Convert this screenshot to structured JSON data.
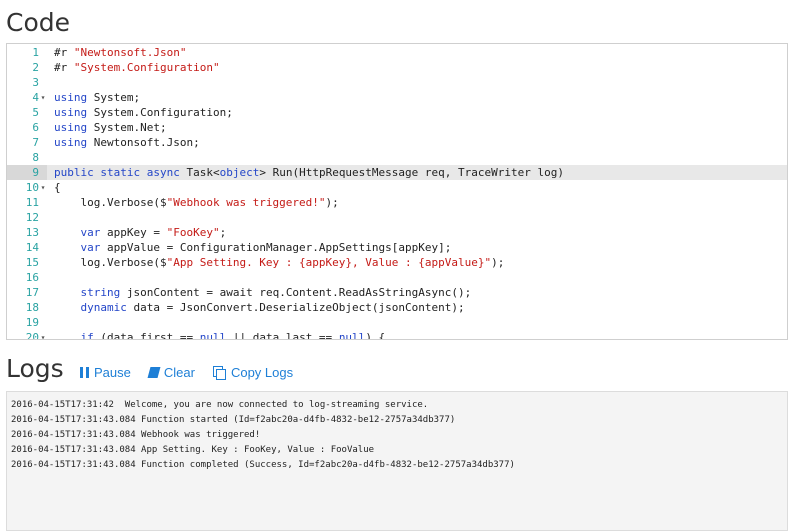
{
  "code_section": {
    "title": "Code",
    "lines": [
      {
        "num": "1",
        "fold": "",
        "tokens": [
          {
            "t": "#r "
          },
          {
            "t": "\"Newtonsoft.Json\"",
            "c": "str"
          }
        ]
      },
      {
        "num": "2",
        "fold": "",
        "tokens": [
          {
            "t": "#r "
          },
          {
            "t": "\"System.Configuration\"",
            "c": "str"
          }
        ]
      },
      {
        "num": "3",
        "fold": "",
        "tokens": []
      },
      {
        "num": "4",
        "fold": "▾",
        "tokens": [
          {
            "t": "using",
            "c": "kw"
          },
          {
            "t": " System;"
          }
        ]
      },
      {
        "num": "5",
        "fold": "",
        "tokens": [
          {
            "t": "using",
            "c": "kw"
          },
          {
            "t": " System.Configuration;"
          }
        ]
      },
      {
        "num": "6",
        "fold": "",
        "tokens": [
          {
            "t": "using",
            "c": "kw"
          },
          {
            "t": " System.Net;"
          }
        ]
      },
      {
        "num": "7",
        "fold": "",
        "tokens": [
          {
            "t": "using",
            "c": "kw"
          },
          {
            "t": " Newtonsoft.Json;"
          }
        ]
      },
      {
        "num": "8",
        "fold": "",
        "tokens": []
      },
      {
        "num": "9",
        "fold": "",
        "active": true,
        "tokens": [
          {
            "t": "public static async",
            "c": "kw"
          },
          {
            "t": " Task<"
          },
          {
            "t": "object",
            "c": "kw"
          },
          {
            "t": "> Run(HttpRequestMessage req, TraceWriter log)"
          }
        ]
      },
      {
        "num": "10",
        "fold": "▾",
        "tokens": [
          {
            "t": "{"
          }
        ]
      },
      {
        "num": "11",
        "fold": "",
        "tokens": [
          {
            "t": "    log.Verbose($"
          },
          {
            "t": "\"Webhook was triggered!\"",
            "c": "str"
          },
          {
            "t": ");"
          }
        ]
      },
      {
        "num": "12",
        "fold": "",
        "tokens": []
      },
      {
        "num": "13",
        "fold": "",
        "tokens": [
          {
            "t": "    "
          },
          {
            "t": "var",
            "c": "kw"
          },
          {
            "t": " appKey = "
          },
          {
            "t": "\"FooKey\"",
            "c": "str"
          },
          {
            "t": ";"
          }
        ]
      },
      {
        "num": "14",
        "fold": "",
        "tokens": [
          {
            "t": "    "
          },
          {
            "t": "var",
            "c": "kw"
          },
          {
            "t": " appValue = ConfigurationManager.AppSettings[appKey];"
          }
        ]
      },
      {
        "num": "15",
        "fold": "",
        "tokens": [
          {
            "t": "    log.Verbose($"
          },
          {
            "t": "\"App Setting. Key : {appKey}, Value : {appValue}\"",
            "c": "str"
          },
          {
            "t": ");"
          }
        ]
      },
      {
        "num": "16",
        "fold": "",
        "tokens": []
      },
      {
        "num": "17",
        "fold": "",
        "tokens": [
          {
            "t": "    "
          },
          {
            "t": "string",
            "c": "kw"
          },
          {
            "t": " jsonContent = await req.Content.ReadAsStringAsync();"
          }
        ]
      },
      {
        "num": "18",
        "fold": "",
        "tokens": [
          {
            "t": "    "
          },
          {
            "t": "dynamic",
            "c": "kw"
          },
          {
            "t": " data = JsonConvert.DeserializeObject(jsonContent);"
          }
        ]
      },
      {
        "num": "19",
        "fold": "",
        "tokens": []
      },
      {
        "num": "20",
        "fold": "▾",
        "tokens": [
          {
            "t": "    "
          },
          {
            "t": "if",
            "c": "kw"
          },
          {
            "t": " (data.first == "
          },
          {
            "t": "null",
            "c": "kw"
          },
          {
            "t": " || data.last == "
          },
          {
            "t": "null",
            "c": "kw"
          },
          {
            "t": ") {"
          }
        ]
      }
    ]
  },
  "logs_section": {
    "title": "Logs",
    "toolbar": {
      "pause_label": "Pause",
      "clear_label": "Clear",
      "copy_label": "Copy Logs"
    },
    "lines": [
      "2016-04-15T17:31:42  Welcome, you are now connected to log-streaming service.",
      "2016-04-15T17:31:43.084 Function started (Id=f2abc20a-d4fb-4832-be12-2757a34db377)",
      "2016-04-15T17:31:43.084 Webhook was triggered!",
      "2016-04-15T17:31:43.084 App Setting. Key : FooKey, Value : FooValue",
      "2016-04-15T17:31:43.084 Function completed (Success, Id=f2abc20a-d4fb-4832-be12-2757a34db377)"
    ]
  },
  "icons": {
    "pause": "pause-icon",
    "clear": "clear-icon",
    "copy": "copy-icon",
    "fold": "fold-arrow-icon"
  },
  "colors": {
    "line_number": "#2aa3a3",
    "keyword": "#2446c8",
    "string": "#c41a16",
    "toolbar_link": "#1e7fd6",
    "log_background": "#f4f4f4"
  }
}
